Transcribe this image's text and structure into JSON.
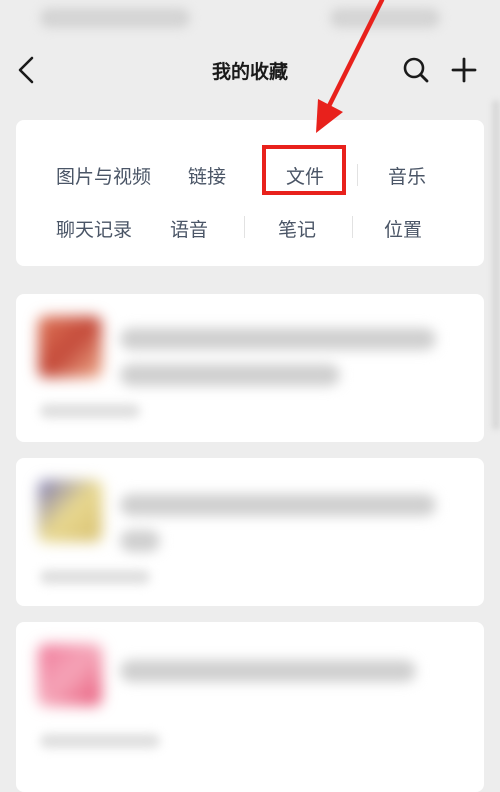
{
  "nav": {
    "title": "我的收藏"
  },
  "filters": [
    {
      "label": "图片与视频"
    },
    {
      "label": "链接"
    },
    {
      "label": "文件"
    },
    {
      "label": "音乐"
    },
    {
      "label": "聊天记录"
    },
    {
      "label": "语音"
    },
    {
      "label": "笔记"
    },
    {
      "label": "位置"
    }
  ],
  "colors": {
    "annotation": "#e8211c",
    "filter_text": "#4a5566",
    "background": "#ededed",
    "card": "#ffffff"
  },
  "icons": [
    "back-chevron-icon",
    "search-icon",
    "plus-icon",
    "annotation-arrow"
  ]
}
